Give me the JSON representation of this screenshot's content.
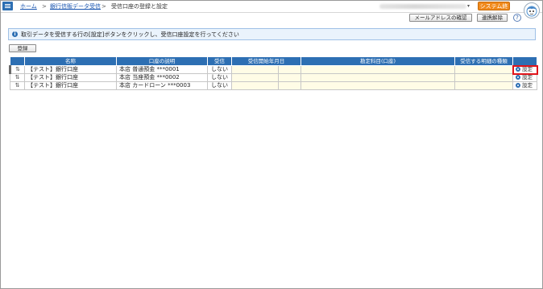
{
  "header": {
    "breadcrumb": {
      "home": "ホーム",
      "sep1": ">",
      "section": "銀行信販データ受信",
      "sep2": ">",
      "current": "受信口座の登録と設定"
    },
    "exit_label": "システム終了",
    "email_check_label": "メールアドレスの確認",
    "link_cancel_label": "連携解除",
    "help_label": "?"
  },
  "info": {
    "icon": "i",
    "text": "取引データを受信する行の[設定]ボタンをクリックし、受信口座設定を行ってください"
  },
  "toolbar": {
    "register_label": "登録"
  },
  "table": {
    "columns": [
      "",
      "名称",
      "口座の説明",
      "受信",
      "受信開始年月日",
      "",
      "勘定科目(口座)",
      "",
      "受信する明細の種類",
      ""
    ],
    "rows": [
      {
        "sort": "⇅",
        "name": "【テスト】銀行口座",
        "desc": "本店 普通預金 ***0001",
        "receive": "しない",
        "setting": "設定"
      },
      {
        "sort": "⇅",
        "name": "【テスト】銀行口座",
        "desc": "本店 当座預金 ***0002",
        "receive": "しない",
        "setting": "設定"
      },
      {
        "sort": "⇅",
        "name": "【テスト】銀行口座",
        "desc": "本店 カードローン ***0003",
        "receive": "しない",
        "setting": "設定"
      }
    ]
  },
  "colors": {
    "header_blue": "#2d6fb3",
    "exit_orange": "#f08a1c",
    "highlight_red": "#e0141b",
    "cell_yellow": "#fffce6"
  }
}
